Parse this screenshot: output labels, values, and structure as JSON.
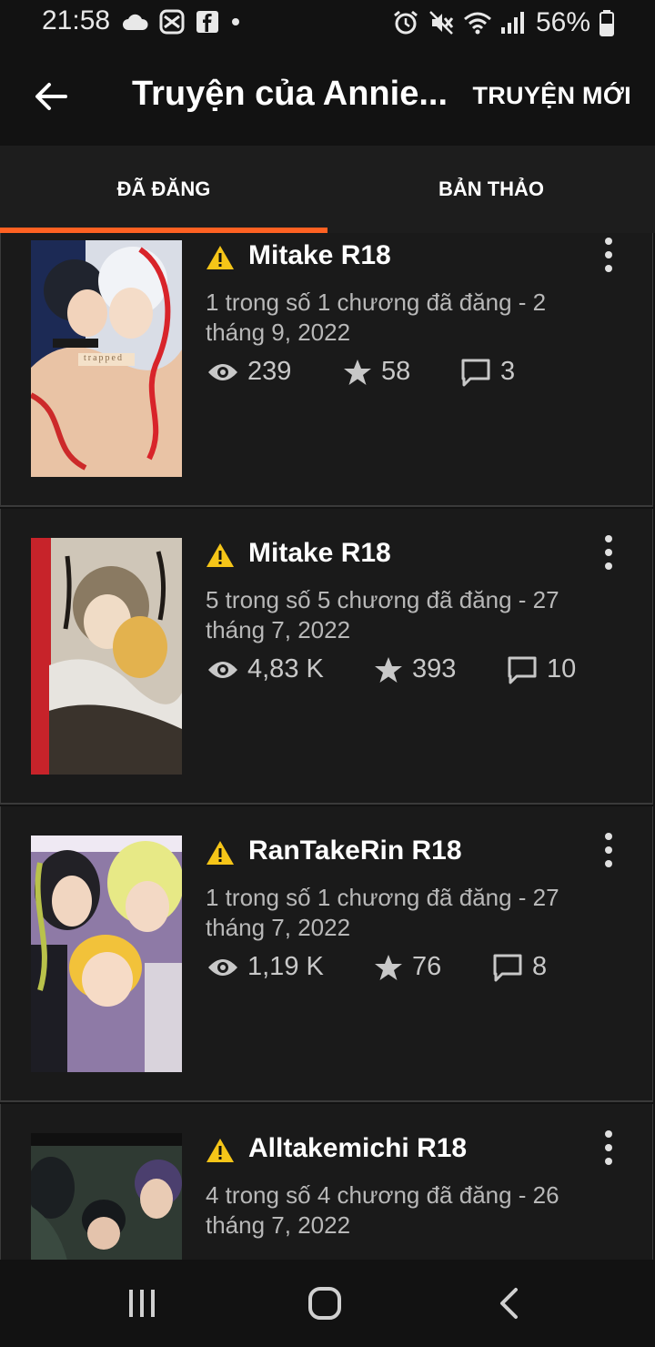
{
  "status_bar": {
    "time": "21:58",
    "battery": "56%",
    "left_icons": [
      "cloud-icon",
      "gallery-icon",
      "facebook-icon",
      "dot-icon"
    ],
    "right_icons": [
      "alarm-icon",
      "mute-icon",
      "wifi-icon",
      "signal-icon",
      "battery-icon"
    ]
  },
  "app_bar": {
    "title": "Truyện của Annie...",
    "new_story_label": "TRUYỆN MỚI"
  },
  "tabs": [
    {
      "label": "ĐÃ ĐĂNG",
      "selected": true
    },
    {
      "label": "BẢN THẢO",
      "selected": false
    }
  ],
  "colors": {
    "accent": "#ff6122",
    "warning": "#f5c518",
    "background": "#121212",
    "card": "#1a1a1a"
  },
  "stories": [
    {
      "title": "Mitake R18",
      "meta": "1 trong số 1 chương đã đăng - 2 tháng 9, 2022",
      "views": "239",
      "votes": "58",
      "comments": "3"
    },
    {
      "title": "Mitake R18",
      "meta": "5 trong số 5 chương đã đăng - 27 tháng 7, 2022",
      "views": "4,83 K",
      "votes": "393",
      "comments": "10"
    },
    {
      "title": "RanTakeRin R18",
      "meta": "1 trong số 1 chương đã đăng - 27 tháng 7, 2022",
      "views": "1,19 K",
      "votes": "76",
      "comments": "8"
    },
    {
      "title": "Alltakemichi R18",
      "meta": "4 trong số 4 chương đã đăng - 26 tháng 7, 2022",
      "views": "",
      "votes": "",
      "comments": ""
    }
  ],
  "cover_texts": [
    "trapped"
  ],
  "nav_bar": [
    "recent-apps-icon",
    "home-icon",
    "back-icon"
  ]
}
